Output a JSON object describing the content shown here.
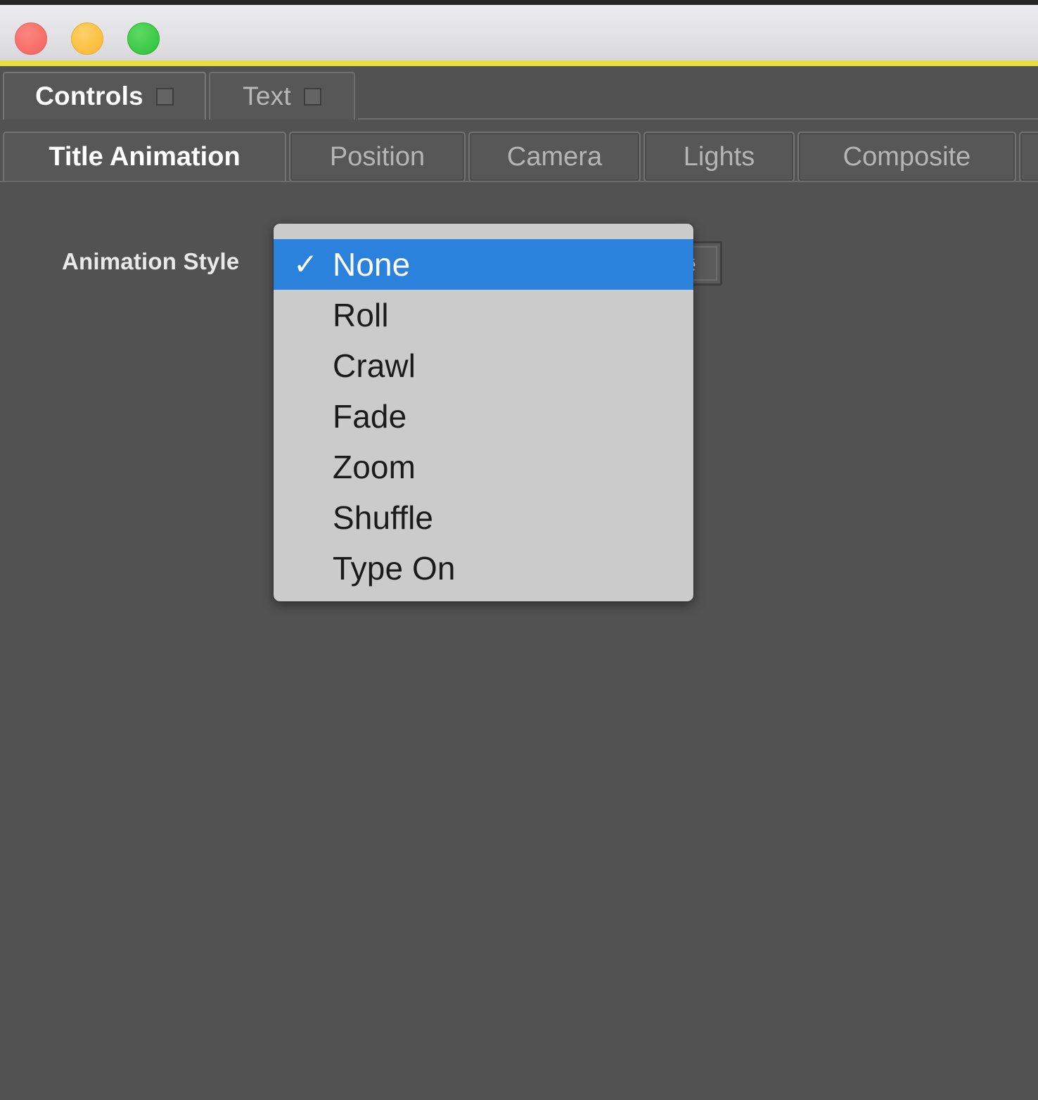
{
  "window": {
    "traffic_lights": [
      {
        "name": "close",
        "color": "#f76f6a"
      },
      {
        "name": "minimize",
        "color": "#fcc143"
      },
      {
        "name": "maximize",
        "color": "#3ecb47"
      }
    ],
    "accent_color": "#e8de3d"
  },
  "primary_tabs": [
    {
      "label": "Controls",
      "active": true,
      "has_checkbox": true
    },
    {
      "label": "Text",
      "active": false,
      "has_checkbox": true
    }
  ],
  "secondary_tabs": [
    {
      "label": "Title Animation",
      "active": true
    },
    {
      "label": "Position",
      "active": false
    },
    {
      "label": "Camera",
      "active": false
    },
    {
      "label": "Lights",
      "active": false
    },
    {
      "label": "Composite",
      "active": false
    },
    {
      "label": "",
      "active": false
    }
  ],
  "content": {
    "field": {
      "label": "Animation Style",
      "selected_value": "None",
      "arrow_icon": "chevron-down-icon"
    }
  },
  "popup_menu": {
    "check_glyph": "✓",
    "items": [
      {
        "label": "None",
        "selected": true
      },
      {
        "label": "Roll",
        "selected": false
      },
      {
        "label": "Crawl",
        "selected": false
      },
      {
        "label": "Fade",
        "selected": false
      },
      {
        "label": "Zoom",
        "selected": false
      },
      {
        "label": "Shuffle",
        "selected": false
      },
      {
        "label": "Type On",
        "selected": false
      }
    ],
    "background_color": "#cbcbcb",
    "highlight_color": "#2b82dc"
  }
}
